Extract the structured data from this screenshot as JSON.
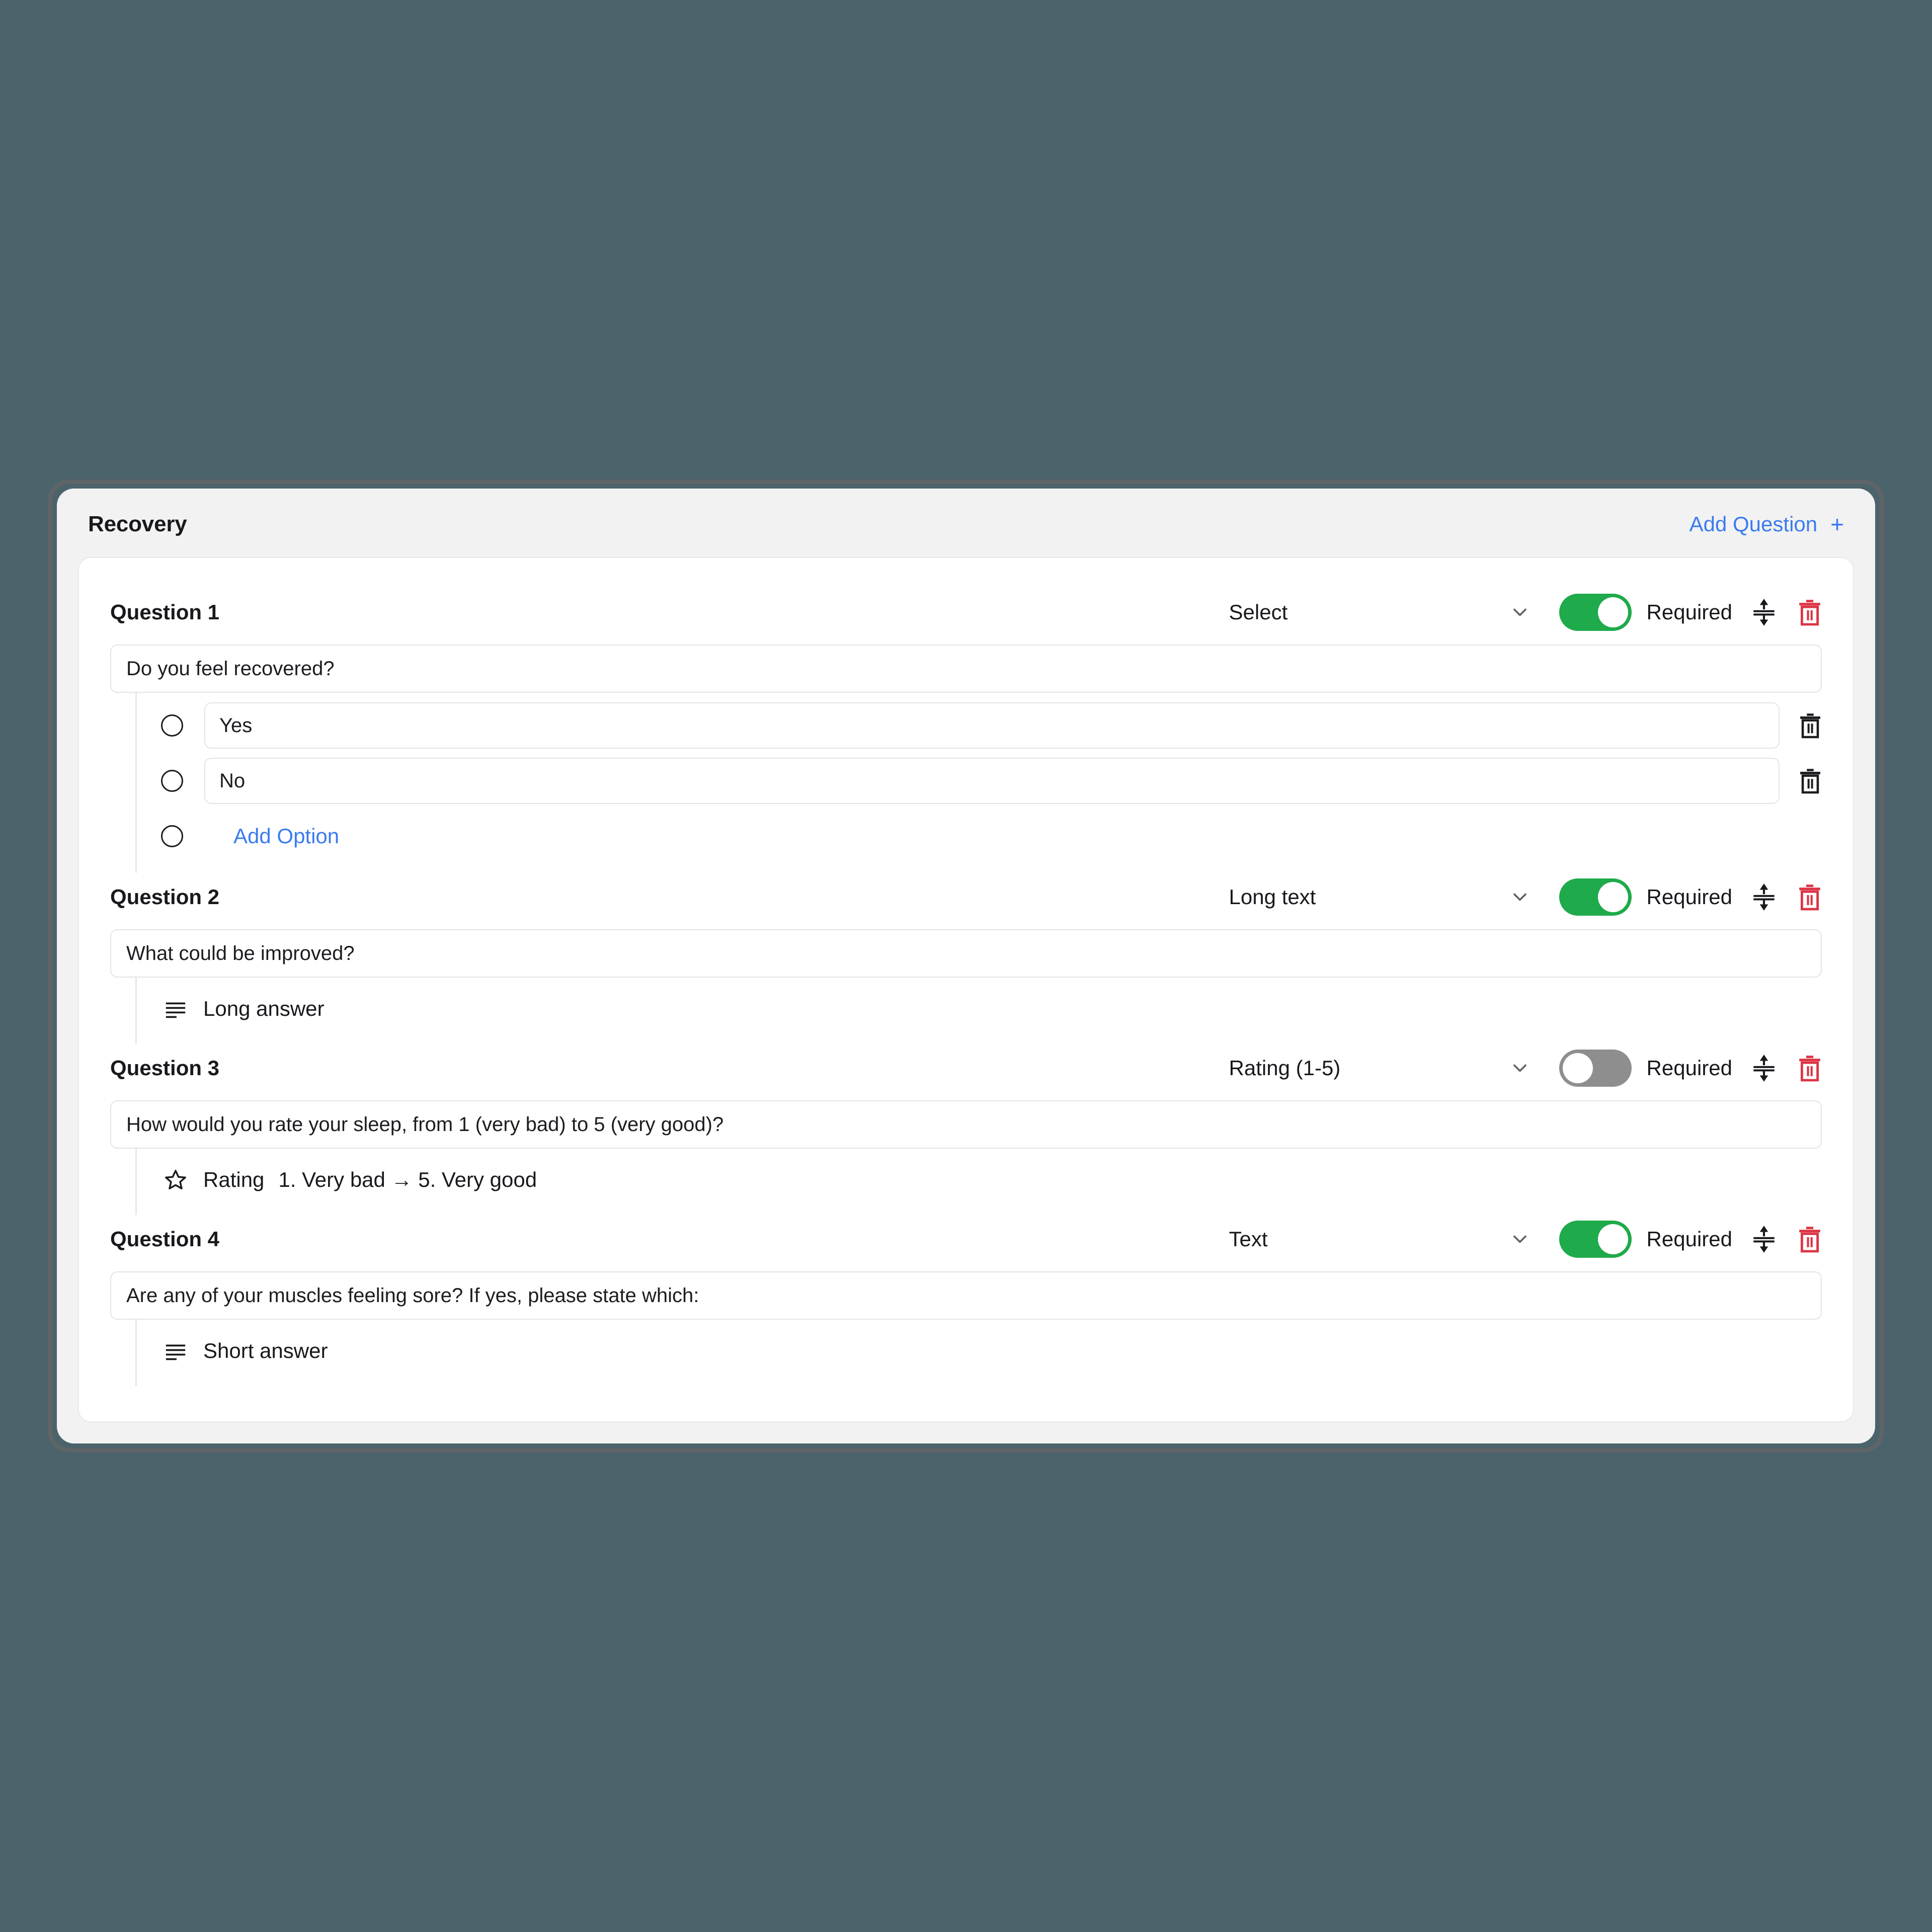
{
  "card": {
    "title": "Recovery",
    "add_question_label": "Add Question",
    "add_question_icon": "plus-icon"
  },
  "common": {
    "required_label": "Required",
    "reorder_icon": "reorder-vertical-icon",
    "delete_icon": "trash-icon",
    "chevron_icon": "chevron-down-icon",
    "add_option_label": "Add Option",
    "radio_icon": "radio-circle-icon"
  },
  "colors": {
    "page_background": "#4b636b",
    "frame_border": "#5e6468",
    "card_background": "#f2f2f2",
    "panel_background": "#ffffff",
    "accent_link": "#3b7bf0",
    "toggle_on": "#1faa4b",
    "toggle_off": "#8e8e8e",
    "delete_red": "#dc3545",
    "text_primary": "#17191c",
    "border_grey": "#e3e4e6"
  },
  "questions": [
    {
      "label": "Question 1",
      "type": "Select",
      "required": true,
      "text": "Do you feel recovered?",
      "body_kind": "options",
      "options": [
        {
          "text": "Yes"
        },
        {
          "text": "No"
        }
      ]
    },
    {
      "label": "Question 2",
      "type": "Long text",
      "required": true,
      "text": "What could be improved?",
      "body_kind": "preview",
      "preview_icon": "text-lines-icon",
      "preview_text": "Long answer"
    },
    {
      "label": "Question 3",
      "type": "Rating (1-5)",
      "required": false,
      "text": "How would you rate your sleep, from 1 (very bad) to 5 (very good)?",
      "body_kind": "rating",
      "preview_icon": "star-icon",
      "preview_text": "Rating",
      "rating_range": "1. Very bad → 5. Very good"
    },
    {
      "label": "Question 4",
      "type": "Text",
      "required": true,
      "text": "Are any of your muscles feeling sore? If yes, please state which:",
      "body_kind": "preview",
      "preview_icon": "text-lines-icon",
      "preview_text": "Short answer"
    }
  ]
}
